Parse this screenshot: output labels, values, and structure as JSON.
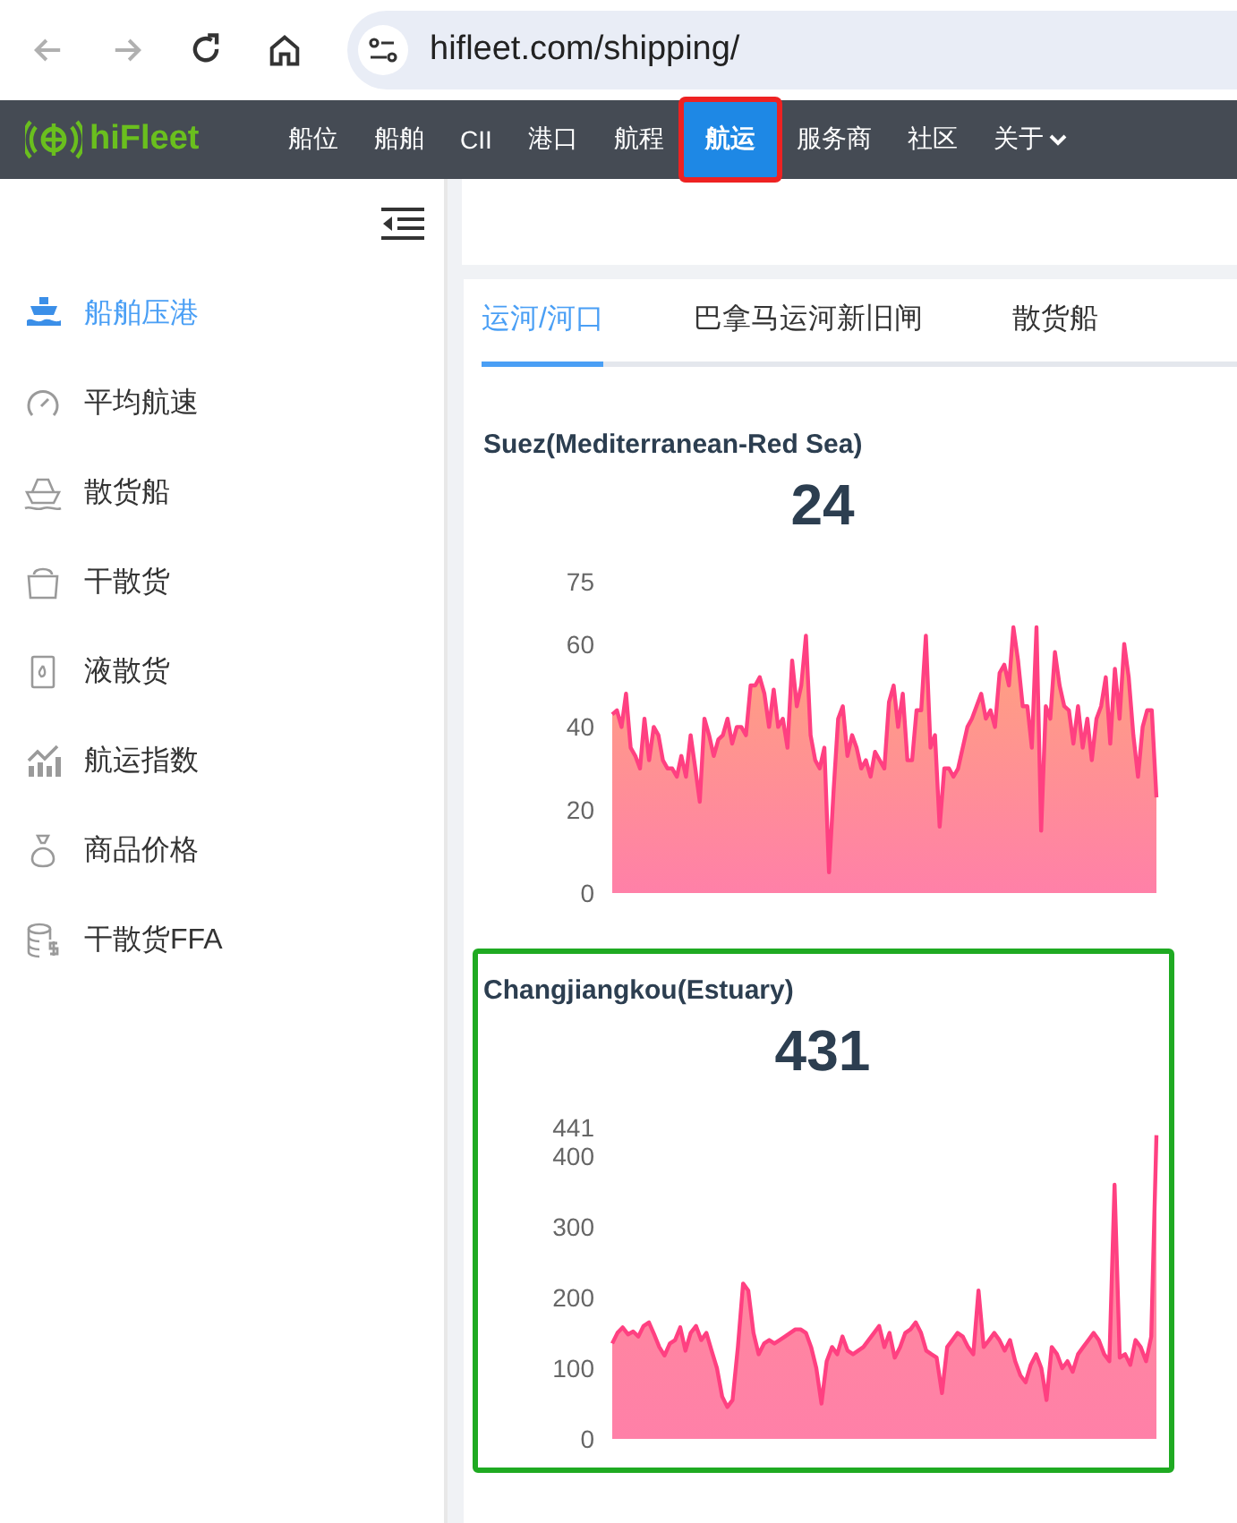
{
  "browser": {
    "address": "hifleet.com/shipping/"
  },
  "nav": {
    "logo": "hiFleet",
    "items": [
      {
        "label": "船位",
        "selected": false,
        "highlighted": false,
        "kind": "link"
      },
      {
        "label": "船舶",
        "selected": false,
        "highlighted": false,
        "kind": "link"
      },
      {
        "label": "CII",
        "selected": false,
        "highlighted": false,
        "kind": "link"
      },
      {
        "label": "港口",
        "selected": false,
        "highlighted": false,
        "kind": "link"
      },
      {
        "label": "航程",
        "selected": false,
        "highlighted": false,
        "kind": "link"
      },
      {
        "label": "航运",
        "selected": true,
        "highlighted": true,
        "kind": "link"
      },
      {
        "label": "服务商",
        "selected": false,
        "highlighted": false,
        "kind": "link"
      },
      {
        "label": "社区",
        "selected": false,
        "highlighted": false,
        "kind": "link"
      },
      {
        "label": "关于",
        "selected": false,
        "highlighted": false,
        "kind": "dropdown"
      }
    ]
  },
  "sidebar": {
    "items": [
      {
        "label": "船舶压港",
        "selected": true
      },
      {
        "label": "平均航速",
        "selected": false
      },
      {
        "label": "散货船",
        "selected": false
      },
      {
        "label": "干散货",
        "selected": false
      },
      {
        "label": "液散货",
        "selected": false
      },
      {
        "label": "航运指数",
        "selected": false
      },
      {
        "label": "商品价格",
        "selected": false
      },
      {
        "label": "干散货FFA",
        "selected": false
      }
    ]
  },
  "tabs": [
    {
      "label": "运河/河口",
      "selected": true
    },
    {
      "label": "巴拿马运河新旧闸",
      "selected": false
    },
    {
      "label": "散货船",
      "selected": false
    }
  ],
  "cards": [
    {
      "title": "Suez(Mediterranean-Red Sea)",
      "value": "24",
      "highlighted": false,
      "chart_data": {
        "type": "area",
        "ylim": [
          0,
          75
        ],
        "yticks": [
          0,
          20,
          40,
          60,
          75
        ],
        "series": [
          {
            "color": "#ff4081",
            "values": [
              43,
              44,
              40,
              48,
              35,
              33,
              30,
              42,
              32,
              40,
              38,
              32,
              30,
              30,
              28,
              33,
              28,
              38,
              30,
              22,
              42,
              38,
              33,
              37,
              38,
              42,
              36,
              40,
              40,
              38,
              50,
              50,
              52,
              48,
              40,
              49,
              40,
              42,
              35,
              56,
              45,
              50,
              62,
              38,
              32,
              30,
              35,
              5,
              25,
              42,
              45,
              33,
              38,
              35,
              30,
              32,
              28,
              34,
              32,
              30,
              46,
              50,
              40,
              48,
              32,
              32,
              44,
              44,
              62,
              35,
              38,
              16,
              30,
              30,
              28,
              30,
              35,
              40,
              42,
              45,
              48,
              42,
              44,
              40,
              53,
              55,
              50,
              64,
              56,
              45,
              45,
              35,
              64,
              15,
              45,
              42,
              58,
              50,
              45,
              44,
              36,
              45,
              35,
              42,
              32,
              42,
              45,
              52,
              36,
              54,
              42,
              60,
              52,
              38,
              28,
              40,
              44,
              44,
              23
            ]
          }
        ]
      }
    },
    {
      "title": "Changjiangkou(Estuary)",
      "value": "431",
      "highlighted": true,
      "chart_data": {
        "type": "area",
        "ylim": [
          0,
          441
        ],
        "yticks": [
          0,
          100,
          200,
          300,
          400,
          441
        ],
        "series": [
          {
            "color": "#ff4081",
            "values": [
              135,
              150,
              158,
              148,
              152,
              145,
              160,
              165,
              148,
              130,
              118,
              135,
              140,
              158,
              125,
              150,
              160,
              140,
              150,
              125,
              100,
              60,
              45,
              55,
              130,
              220,
              210,
              150,
              120,
              135,
              140,
              135,
              140,
              145,
              150,
              155,
              155,
              150,
              130,
              100,
              50,
              110,
              130,
              120,
              145,
              125,
              120,
              125,
              130,
              140,
              150,
              160,
              130,
              150,
              115,
              130,
              150,
              155,
              165,
              150,
              125,
              120,
              115,
              65,
              130,
              140,
              150,
              145,
              130,
              120,
              210,
              130,
              140,
              150,
              140,
              125,
              140,
              110,
              90,
              80,
              105,
              120,
              100,
              55,
              130,
              120,
              100,
              110,
              95,
              120,
              130,
              140,
              150,
              140,
              120,
              110,
              360,
              115,
              120,
              105,
              140,
              130,
              110,
              145,
              430
            ]
          }
        ]
      }
    }
  ]
}
